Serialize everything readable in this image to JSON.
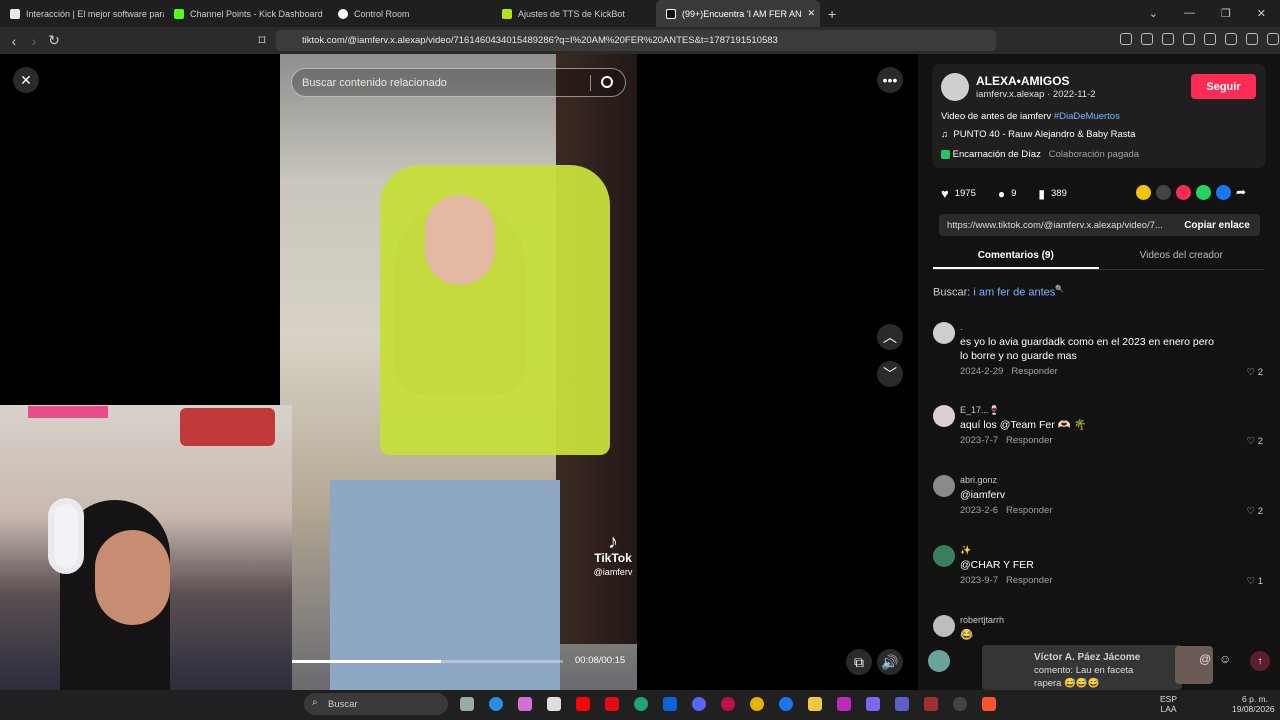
{
  "browser": {
    "tabs": [
      {
        "label": "Interacción | El mejor software para j",
        "color": "#e8e8e8",
        "active": false
      },
      {
        "label": "Channel Points - Kick Dashboard",
        "color": "#53fc18",
        "active": false
      },
      {
        "label": "Control Room",
        "color": "#ffffff",
        "active": false
      },
      {
        "label": "Ajustes de TTS de KickBot",
        "color": "#b6e21a",
        "active": false
      },
      {
        "label": "(99+)Encuentra 'I AM FER AN",
        "color": "#ffffff",
        "active": true
      }
    ],
    "new_tab": "+",
    "address": "tiktok.com/@iamferv.x.alexap/video/7161460434015489286?q=I%20AM%20FER%20ANTES&t=1787191510583"
  },
  "video": {
    "search_placeholder": "Buscar contenido relacionado",
    "watermark_brand": "TikTok",
    "watermark_user": "@iamferv",
    "time": "00:08/00:15",
    "progress": 0.55
  },
  "author": {
    "name": "ALEXA•AMIGOS",
    "handle_date": "iamferv.x.alexap · 2022-11-2",
    "follow": "Seguir",
    "description": "Video de antes de iamferv ",
    "hashtag": "#DiaDeMuertos",
    "music": "PUNTO 40 - Rauw Alejandro & Baby Rasta",
    "sponsor": "Encarnación de Díaz",
    "paid": "Colaboración pagada"
  },
  "stats": {
    "likes": "1975",
    "comments": "9",
    "saves": "389"
  },
  "share": {
    "link": "https://www.tiktok.com/@iamferv.x.alexap/video/7...",
    "copy": "Copiar enlace"
  },
  "panel_tabs": {
    "comments": "Comentarios (9)",
    "creator": "Videos del creador"
  },
  "search_hint": {
    "label": "Buscar:",
    "query": "i am fer de antes"
  },
  "comments": [
    {
      "user": ".",
      "text": "es yo lo avia guardadk como en el 2023 en enero pero lo borre y no guarde mas",
      "date": "2024-2-29",
      "reply": "Responder",
      "likes": "2"
    },
    {
      "user": "E_17...🍷",
      "text": "aquí los @Team Fer 🫶🏻 🌴",
      "date": "2023-7-7",
      "reply": "Responder",
      "likes": "2"
    },
    {
      "user": "abri.gonz",
      "text": "@iamferv",
      "date": "2023-2-6",
      "reply": "Responder",
      "likes": "2"
    },
    {
      "user": "✨",
      "text": "@CHAR Y FER",
      "date": "2023-9-7",
      "reply": "Responder",
      "likes": "1"
    },
    {
      "user": "robertjtarrh",
      "text": "😂",
      "date": "",
      "reply": "",
      "likes": ""
    }
  ],
  "chat_overlay": {
    "name": "Víctor A. Páez Jácome",
    "line1": "comento: Lau en faceta",
    "line2": "rapera 😅😅😅"
  },
  "taskbar": {
    "search": "Buscar",
    "lang": "ESP",
    "region": "LAA",
    "time": "6 p. m.",
    "date": "19/08/2026"
  }
}
